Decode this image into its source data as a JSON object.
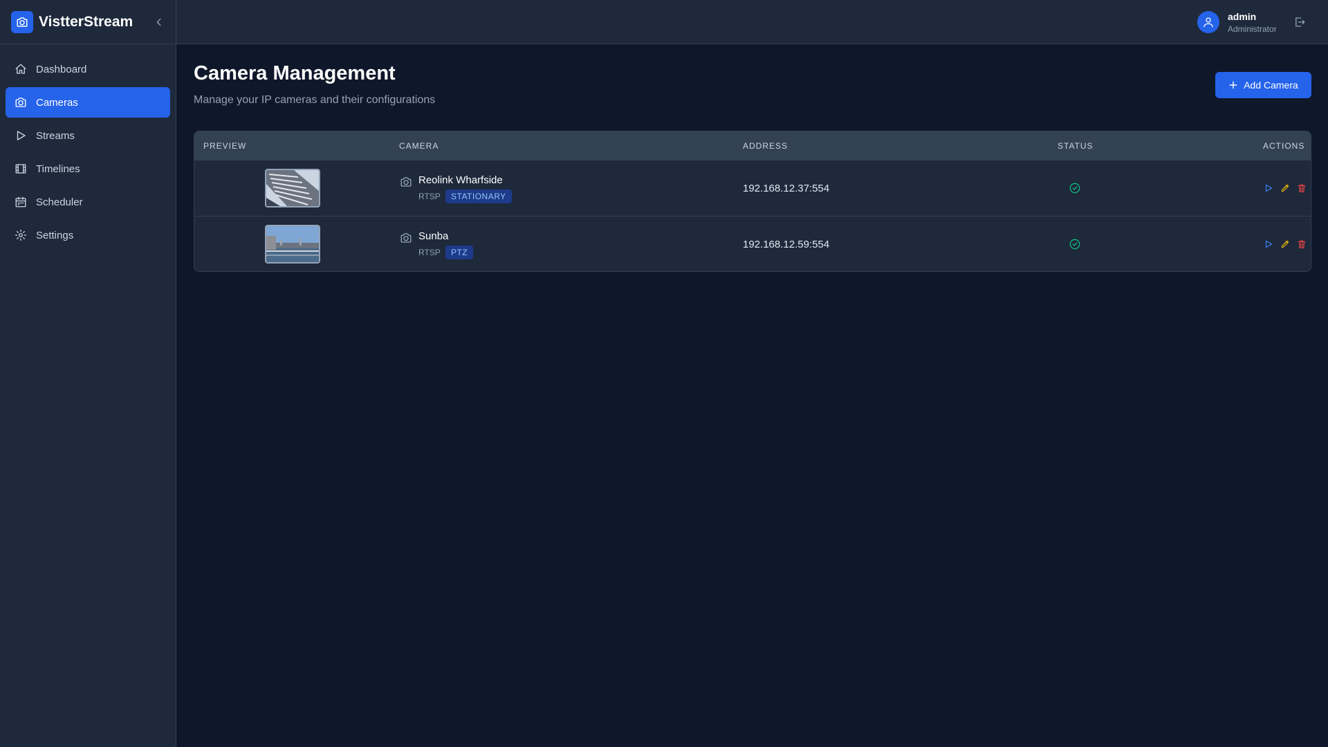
{
  "app": {
    "name": "VistterStream",
    "logo_icon": "camera-icon",
    "collapse_icon": "chevron-left-icon"
  },
  "sidebar": {
    "items": [
      {
        "label": "Dashboard",
        "icon": "home-icon",
        "active": false
      },
      {
        "label": "Cameras",
        "icon": "camera-icon",
        "active": true
      },
      {
        "label": "Streams",
        "icon": "play-icon",
        "active": false
      },
      {
        "label": "Timelines",
        "icon": "film-icon",
        "active": false
      },
      {
        "label": "Scheduler",
        "icon": "calendar-icon",
        "active": false
      },
      {
        "label": "Settings",
        "icon": "gear-icon",
        "active": false
      }
    ]
  },
  "user": {
    "name": "admin",
    "role": "Administrator",
    "avatar_icon": "user-icon",
    "logout_icon": "logout-icon"
  },
  "page": {
    "title": "Camera Management",
    "subtitle": "Manage your IP cameras and their configurations",
    "add_button_label": "Add Camera"
  },
  "table": {
    "columns": [
      "PREVIEW",
      "CAMERA",
      "ADDRESS",
      "STATUS",
      "ACTIONS"
    ],
    "rows": [
      {
        "name": "Reolink Wharfside",
        "protocol": "RTSP",
        "type": "STATIONARY",
        "address": "192.168.12.37:554",
        "status": "online",
        "preview": "building-closeup"
      },
      {
        "name": "Sunba",
        "protocol": "RTSP",
        "type": "PTZ",
        "address": "192.168.12.59:554",
        "status": "online",
        "preview": "harbor-view"
      }
    ]
  },
  "colors": {
    "background": "#0f172a",
    "panel": "#1e293b",
    "accent": "#2563eb",
    "status_ok": "#10b981",
    "edit": "#eab308",
    "delete": "#ef4444",
    "play": "#3b82f6"
  }
}
